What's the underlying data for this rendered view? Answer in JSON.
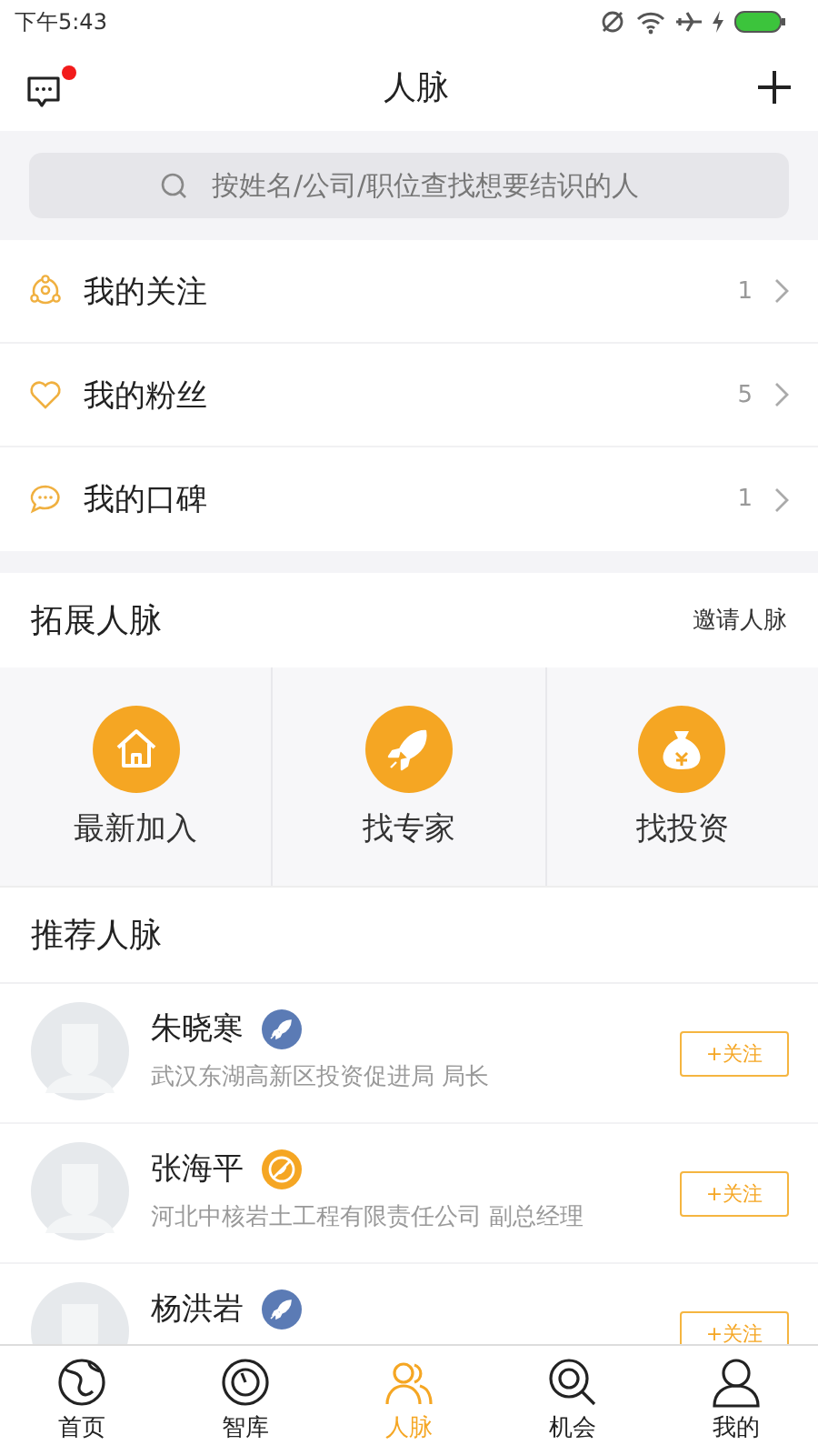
{
  "status_bar": {
    "time": "下午5:43"
  },
  "header": {
    "title": "人脉",
    "has_unread": true
  },
  "search": {
    "placeholder": "按姓名/公司/职位查找想要结识的人"
  },
  "my_list": [
    {
      "kind": "follow",
      "label": "我的关注",
      "count": "1"
    },
    {
      "kind": "fans",
      "label": "我的粉丝",
      "count": "5"
    },
    {
      "kind": "reputation",
      "label": "我的口碑",
      "count": "1"
    }
  ],
  "expand": {
    "title": "拓展人脉",
    "link": "邀请人脉",
    "shortcuts": [
      {
        "kind": "home",
        "label": "最新加入"
      },
      {
        "kind": "rocket",
        "label": "找专家"
      },
      {
        "kind": "money",
        "label": "找投资"
      }
    ]
  },
  "recommend": {
    "title": "推荐人脉",
    "people": [
      {
        "name": "朱晓寒",
        "kind": "rocket",
        "subtitle": "武汉东湖高新区投资促进局 局长",
        "follow": "+关注"
      },
      {
        "name": "张海平",
        "kind": "medal",
        "subtitle": "河北中核岩土工程有限责任公司 副总经理",
        "follow": "+关注"
      },
      {
        "name": "杨洪岩",
        "kind": "rocket",
        "follow": "+关注"
      }
    ]
  },
  "tab_bar": [
    {
      "kind": "globe",
      "label": "首页",
      "selected": false
    },
    {
      "kind": "dial",
      "label": "智库",
      "selected": false
    },
    {
      "kind": "people",
      "label": "人脉",
      "selected": true
    },
    {
      "kind": "search",
      "label": "机会",
      "selected": false
    },
    {
      "kind": "person",
      "label": "我的",
      "selected": false
    }
  ]
}
